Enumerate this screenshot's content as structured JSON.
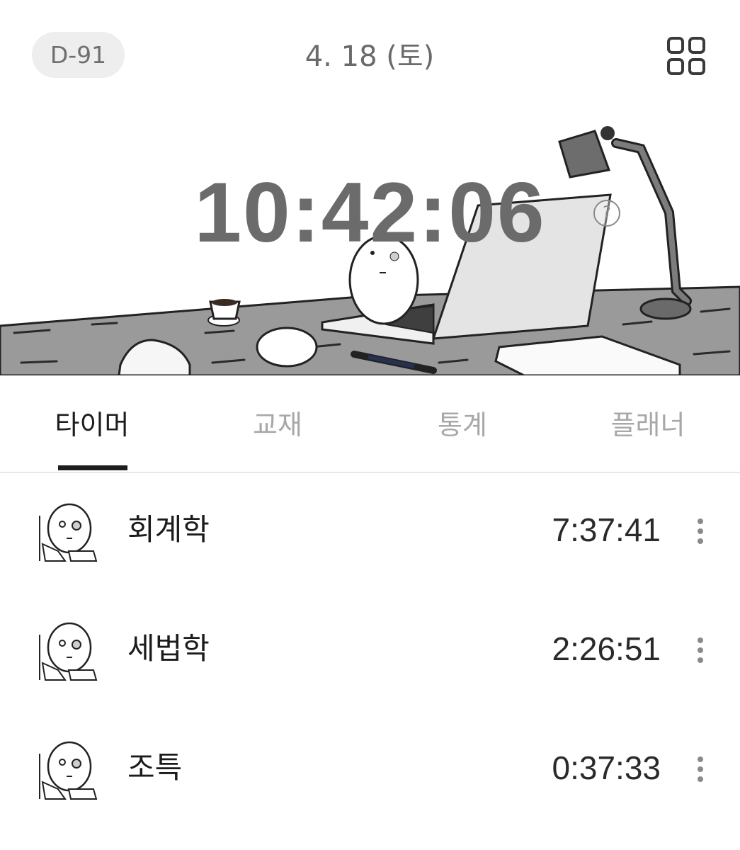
{
  "header": {
    "dday": "D-91",
    "date": "4. 18 (토)",
    "menu_icon": "grid-icon"
  },
  "hero": {
    "timer": "10:42:06",
    "help_icon": "question-circle-icon",
    "help_glyph": "?"
  },
  "tabs": [
    {
      "label": "타이머",
      "active": true
    },
    {
      "label": "교재",
      "active": false
    },
    {
      "label": "통계",
      "active": false
    },
    {
      "label": "플래너",
      "active": false
    }
  ],
  "subjects": [
    {
      "name": "회계학",
      "time": "7:37:41",
      "icon": "character-avatar-icon",
      "more_icon": "more-vertical-icon"
    },
    {
      "name": "세법학",
      "time": "2:26:51",
      "icon": "character-avatar-icon",
      "more_icon": "more-vertical-icon"
    },
    {
      "name": "조특",
      "time": "0:37:33",
      "icon": "character-avatar-icon",
      "more_icon": "more-vertical-icon"
    }
  ]
}
